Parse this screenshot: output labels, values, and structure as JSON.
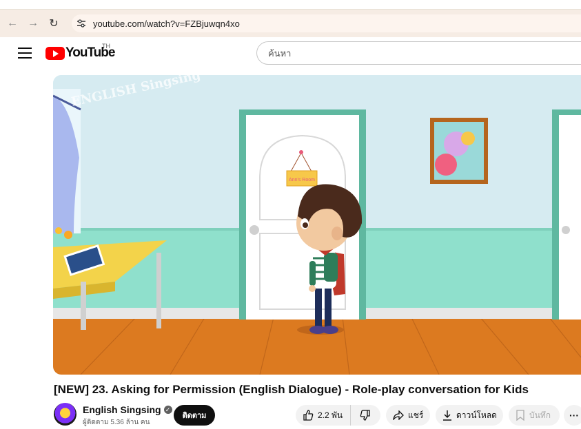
{
  "browser": {
    "url": "youtube.com/watch?v=FZBjuwqn4xo",
    "icons": [
      "back-arrow-icon",
      "forward-arrow-icon",
      "reload-icon",
      "site-settings-icon"
    ]
  },
  "header": {
    "logo_text": "YouTube",
    "country_code": "TH",
    "search_placeholder": "ค้นหา"
  },
  "video": {
    "watermark": "ENGLISH Singsing",
    "door_sign": "Ann's Room",
    "colors": {
      "wall": "#d6ebf1",
      "wainscot": "#8fe0cc",
      "floor": "#dc7a20",
      "door_frame": "#5fb8a0"
    }
  },
  "title": "[NEW] 23. Asking for Permission (English Dialogue) - Role-play conversation for Kids",
  "channel": {
    "name": "English Singsing",
    "subscribers": "ผู้ติดตาม 5.36 ล้าน คน",
    "subscribe_label": "ติดตาม"
  },
  "actions": {
    "likes": "2.2 พัน",
    "share_label": "แชร์",
    "download_label": "ดาวน์โหลด",
    "save_label": "บันทึก",
    "more_label": "···"
  }
}
